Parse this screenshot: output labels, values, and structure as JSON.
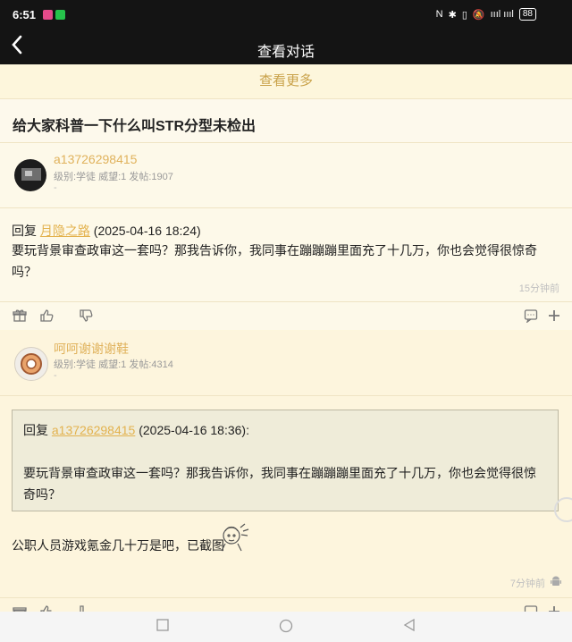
{
  "status": {
    "time": "6:51",
    "signal": "ıııl  ıııl",
    "battery": "88"
  },
  "nav": {
    "title": "查看对话"
  },
  "load_more": "查看更多",
  "thread_title": "给大家科普一下什么叫STR分型未检出",
  "posts": [
    {
      "user": "a13726298415",
      "meta": "级别:学徒 威望:1 发帖:1907",
      "dash": "-",
      "reply_prefix": "回复",
      "reply_to": "月隐之路",
      "reply_time": "(2025-04-16 18:24)",
      "text": "要玩背景审查政审这一套吗？那我告诉你，我同事在蹦蹦蹦里面充了十几万，你也会觉得很惊奇吗？",
      "time_ago": "15分钟前"
    },
    {
      "user": "呵呵谢谢谢鞋",
      "meta": "级别:学徒 威望:1 发帖:4314",
      "dash": "-",
      "quote_prefix": "回复",
      "quote_to": "a13726298415",
      "quote_time": "(2025-04-16 18:36):",
      "quote_text": "要玩背景审查政审这一套吗？那我告诉你，我同事在蹦蹦蹦里面充了十几万，你也会觉得很惊奇吗？",
      "text": "公职人员游戏氪金几十万是吧，已截图",
      "time_ago": "7分钟前"
    }
  ],
  "icons": {
    "back": "chevron-left-icon",
    "gift": "gift-icon",
    "like": "thumbs-up-icon",
    "dislike": "thumbs-down-icon",
    "comment": "comment-icon",
    "add": "plus-icon",
    "android": "android-icon"
  },
  "colors": {
    "accent": "#e0b25c",
    "topbar": "#141414",
    "page_bg": "#fdf6dc"
  }
}
